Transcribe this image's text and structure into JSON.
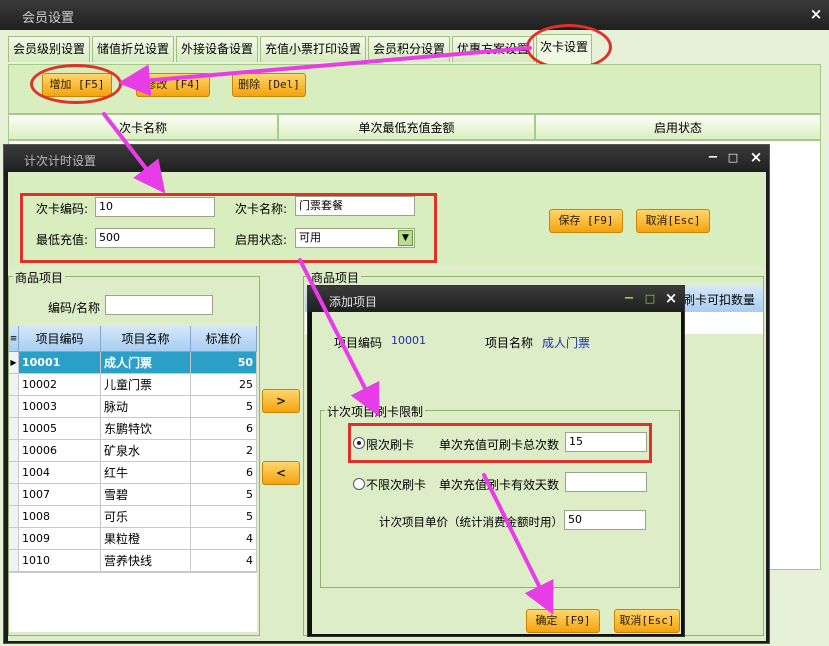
{
  "main_window": {
    "title": "会员设置",
    "close": "×",
    "tabs": [
      {
        "label": "会员级别设置"
      },
      {
        "label": "储值折兑设置"
      },
      {
        "label": "外接设备设置"
      },
      {
        "label": "充值小票打印设置"
      },
      {
        "label": "会员积分设置"
      },
      {
        "label": "优惠方案设置"
      },
      {
        "label": "次卡设置"
      }
    ],
    "toolbar": {
      "add": "增加 [F5]",
      "edit": "修改 [F4]",
      "delete": "删除 [Del]"
    },
    "columns": [
      "次卡名称",
      "单次最低充值金额",
      "启用状态"
    ]
  },
  "count_window": {
    "title": "计次计时设置",
    "controls": {
      "min": "−",
      "max": "□",
      "close": "×"
    },
    "form": {
      "code_label": "次卡编码:",
      "code_value": "10",
      "name_label": "次卡名称:",
      "name_value": "门票套餐",
      "min_label": "最低充值:",
      "min_value": "500",
      "status_label": "启用状态:",
      "status_value": "可用"
    },
    "save": "保存 [F9]",
    "cancel": "取消[Esc]",
    "left_group": {
      "title": "商品项目",
      "search_label": "编码/名称",
      "columns": [
        "项目编码",
        "项目名称",
        "标准价"
      ],
      "rows": [
        {
          "code": "10001",
          "name": "成人门票",
          "price": "50"
        },
        {
          "code": "10002",
          "name": "儿童门票",
          "price": "25"
        },
        {
          "code": "10003",
          "name": "脉动",
          "price": "5"
        },
        {
          "code": "10005",
          "name": "东鹏特饮",
          "price": "6"
        },
        {
          "code": "10006",
          "name": "矿泉水",
          "price": "2"
        },
        {
          "code": "1004",
          "name": "红牛",
          "price": "6"
        },
        {
          "code": "1007",
          "name": "雪碧",
          "price": "5"
        },
        {
          "code": "1008",
          "name": "可乐",
          "price": "5"
        },
        {
          "code": "1009",
          "name": "果粒橙",
          "price": "4"
        },
        {
          "code": "1010",
          "name": "营养快线",
          "price": "4"
        }
      ]
    },
    "right_group": {
      "title": "商品项目",
      "column_tail": "刷卡可扣数量"
    },
    "move_right": ">",
    "move_left": "<"
  },
  "add_dialog": {
    "title": "添加项目",
    "controls": {
      "min": "−",
      "max": "□",
      "close": "×"
    },
    "code_label": "项目编码",
    "code_value": "10001",
    "name_label": "项目名称",
    "name_value": "成人门票",
    "group_title": "计次项目刷卡限制",
    "limited_label": "限次刷卡",
    "limited_field_label": "单次充值可刷卡总次数",
    "limited_value": "15",
    "unlimited_label": "不限次刷卡",
    "unlimited_field_label": "单次充值刷卡有效天数",
    "unlimited_value": "",
    "unit_price_label": "计次项目单价（统计消费金额时用）",
    "unit_price_value": "50",
    "ok": "确定 [F9]",
    "cancel": "取消[Esc]"
  },
  "colors": {
    "accent_green": "#d9eebe",
    "button_orange": "#f4a310",
    "highlight_red": "#e0302a",
    "arrow_magenta": "#e83ce8",
    "selected_row": "#2aa0c8"
  }
}
